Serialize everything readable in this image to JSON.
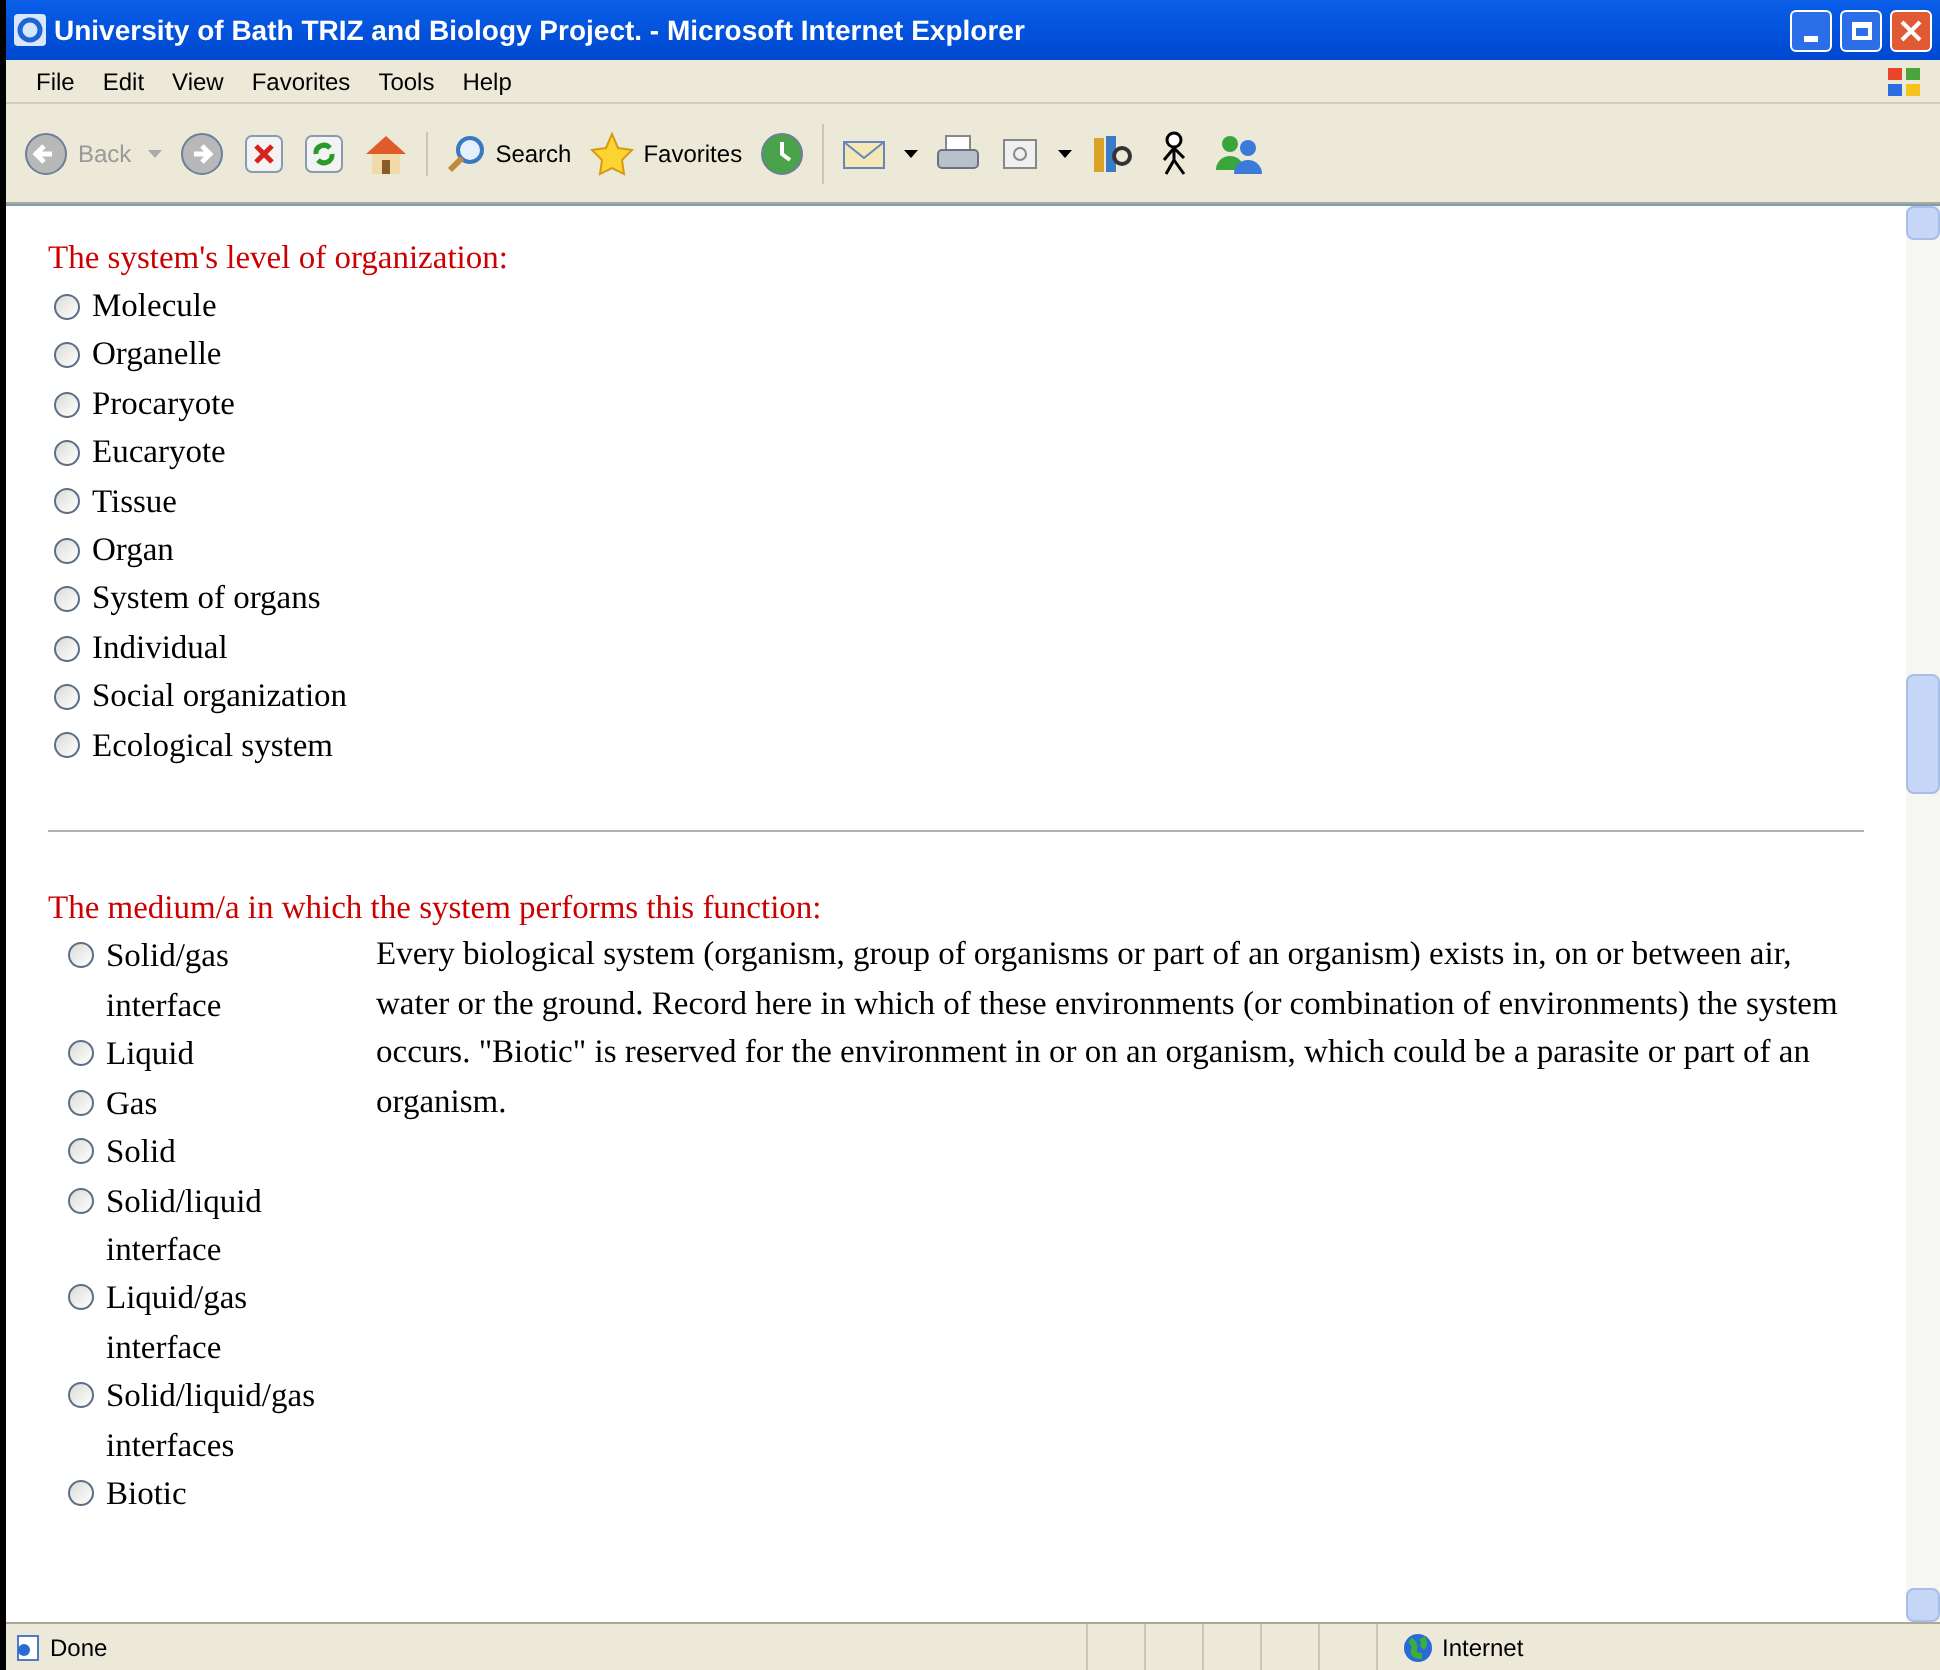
{
  "window": {
    "title": "University of Bath TRIZ and Biology Project. - Microsoft Internet Explorer"
  },
  "menu": [
    "File",
    "Edit",
    "View",
    "Favorites",
    "Tools",
    "Help"
  ],
  "toolbar": {
    "back": "Back",
    "search": "Search",
    "favorites": "Favorites"
  },
  "level_question": {
    "label": "The system's level of organization:",
    "options": [
      {
        "label": "Molecule",
        "selected": false
      },
      {
        "label": "Organelle",
        "selected": false
      },
      {
        "label": "Procaryote",
        "selected": false
      },
      {
        "label": "Eucaryote",
        "selected": false
      },
      {
        "label": "Tissue",
        "selected": false
      },
      {
        "label": "Organ",
        "selected": false
      },
      {
        "label": "System of organs",
        "selected": false
      },
      {
        "label": "Individual",
        "selected": false
      },
      {
        "label": "Social organization",
        "selected": false
      },
      {
        "label": "Ecological system",
        "selected": false
      }
    ]
  },
  "medium_question": {
    "label": "The medium/a in which the system performs this function:",
    "options": [
      {
        "label": "Solid/gas interface",
        "selected": false
      },
      {
        "label": "Liquid",
        "selected": false
      },
      {
        "label": "Gas",
        "selected": false
      },
      {
        "label": "Solid",
        "selected": false
      },
      {
        "label": "Solid/liquid interface",
        "selected": false
      },
      {
        "label": "Liquid/gas interface",
        "selected": false
      },
      {
        "label": "Solid/liquid/gas interfaces",
        "selected": false
      },
      {
        "label": "Biotic",
        "selected": false
      }
    ],
    "help": "Every biological system (organism, group of organisms or part of an organism) exists in, on or between air, water or the ground. Record here in which of these environments (or combination of environments) the system occurs. \"Biotic\" is reserved for the environment in or on an organism, which could be a parasite or part of an organism."
  },
  "status_bar": {
    "text": "Done",
    "zone": "Internet"
  }
}
